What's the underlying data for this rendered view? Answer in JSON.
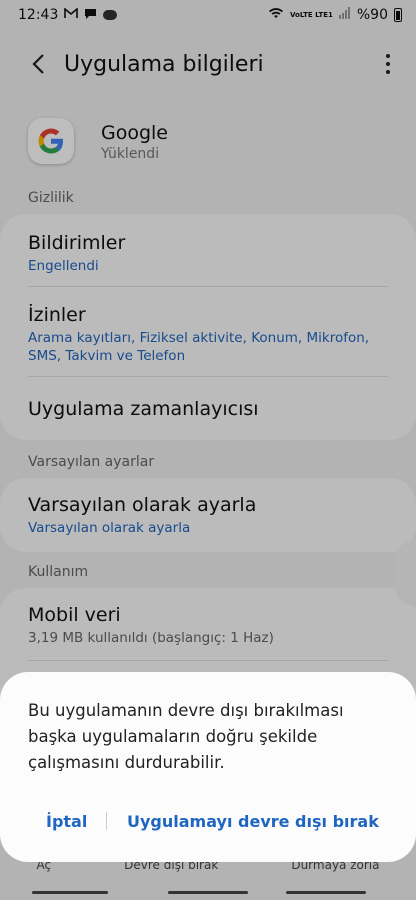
{
  "status_bar": {
    "time": "12:43",
    "icons_left": [
      "gmail-icon",
      "message-icon",
      "notification-pill-icon"
    ],
    "network": "VoLTE LTE1",
    "battery": "%90"
  },
  "header": {
    "title": "Uygulama bilgileri"
  },
  "app": {
    "name": "Google",
    "status": "Yüklendi"
  },
  "sections": {
    "privacy": "Gizlilik",
    "defaults": "Varsayılan ayarlar",
    "usage": "Kullanım"
  },
  "items": {
    "notifications": {
      "title": "Bildirimler",
      "sub": "Engellendi"
    },
    "permissions": {
      "title": "İzinler",
      "sub": "Arama kayıtları, Fiziksel aktivite, Konum, Mikrofon, SMS, Takvim ve Telefon"
    },
    "scheduler": {
      "title": "Uygulama zamanlayıcısı"
    },
    "set_default": {
      "title": "Varsayılan olarak ayarla",
      "sub": "Varsayılan olarak ayarla"
    },
    "mobile_data": {
      "title": "Mobil veri",
      "sub": "3,19 MB kullanıldı (başlangıç: 1 Haz)"
    }
  },
  "bottom_labels": [
    "Aç",
    "Devre dışı bırak",
    "Durmaya zorla"
  ],
  "dialog": {
    "message": "Bu uygulamanın devre dışı bırakılması başka uygulamaların doğru şekilde çalışmasını durdurabilir.",
    "cancel": "İptal",
    "confirm": "Uygulamayı devre dışı bırak"
  },
  "colors": {
    "accent": "#1f65c2",
    "background": "#f2f2f2",
    "card": "#fcfcfc"
  }
}
